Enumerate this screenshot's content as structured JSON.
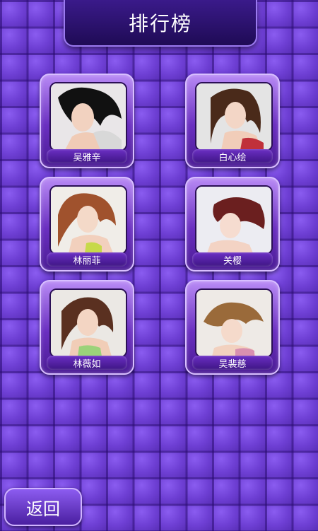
{
  "header": {
    "title": "排行榜"
  },
  "rankings": [
    {
      "name": "吴雅辛"
    },
    {
      "name": "白心绘"
    },
    {
      "name": "林丽菲"
    },
    {
      "name": "关樱"
    },
    {
      "name": "林薇如"
    },
    {
      "name": "吴裴慈"
    }
  ],
  "footer": {
    "back_label": "返回"
  }
}
